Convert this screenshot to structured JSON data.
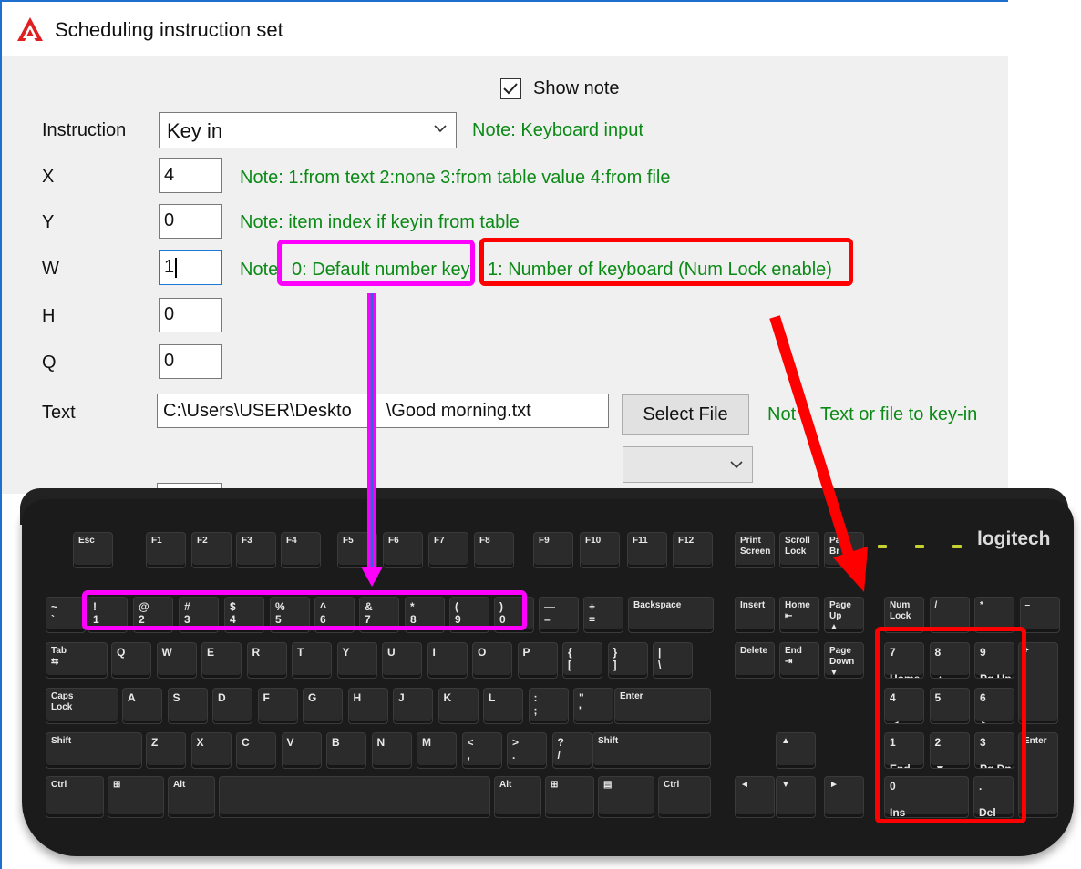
{
  "window": {
    "title": "Scheduling instruction set"
  },
  "show_note": {
    "label": "Show note",
    "checked": true
  },
  "fields": {
    "instruction": {
      "label": "Instruction",
      "value": "Key in",
      "note": "Note: Keyboard input"
    },
    "x": {
      "label": "X",
      "value": "4",
      "note": "Note: 1:from text 2:none 3:from table value 4:from file"
    },
    "y": {
      "label": "Y",
      "value": "0",
      "note": "Note: item index if keyin from table"
    },
    "w": {
      "label": "W",
      "value": "1",
      "note_prefix": "Note",
      "note_opt0": "0: Default number key",
      "note_opt1": "1: Number of keyboard (Num Lock enable)"
    },
    "h": {
      "label": "H",
      "value": "0"
    },
    "q": {
      "label": "Q",
      "value": "0"
    },
    "text": {
      "label": "Text",
      "value": "C:\\Users\\USER\\Deskto",
      "value_tail": "\\Good morning.txt",
      "button": "Select File",
      "note_head": "Not",
      "note_tail": "Text or file to key-in"
    }
  },
  "keyboard": {
    "brand": "logitech",
    "fn_row": [
      "Esc",
      "F1",
      "F2",
      "F3",
      "F4",
      "F5",
      "F6",
      "F7",
      "F8",
      "F9",
      "F10",
      "F11",
      "F12",
      "Print\nScreen",
      "Scroll\nLock",
      "Pa\nBr"
    ],
    "number_row": [
      "~\n`",
      "!\n1",
      "@\n2",
      "#\n3",
      "$\n4",
      "%\n5",
      "^\n6",
      "&\n7",
      "*\n8",
      "(\n9",
      ")\n0",
      "—\n–",
      "+\n=",
      "Backspace"
    ],
    "nav_row1": [
      "Insert",
      "Home\n⇤",
      "Page\nUp\n▲"
    ],
    "nav_row2": [
      "Delete",
      "End\n⇥",
      "Page\nDown\n▼"
    ],
    "row_q": [
      "Tab\n⇆",
      "Q",
      "W",
      "E",
      "R",
      "T",
      "Y",
      "U",
      "I",
      "O",
      "P",
      "{\n[",
      "}\n]",
      "|\n\\"
    ],
    "row_a": [
      "Caps\nLock",
      "A",
      "S",
      "D",
      "F",
      "G",
      "H",
      "J",
      "K",
      "L",
      ":\n;",
      "\"\n'",
      "Enter"
    ],
    "row_z": [
      "Shift",
      "Z",
      "X",
      "C",
      "V",
      "B",
      "N",
      "M",
      "<\n,",
      ">\n.",
      "?\n/",
      "Shift"
    ],
    "row_bottom": [
      "Ctrl",
      "⊞",
      "Alt",
      "",
      "Alt",
      "⊞",
      "▤",
      "Ctrl"
    ],
    "arrows": [
      "▲",
      "◄",
      "▼",
      "►"
    ],
    "numpad_top": [
      "Num\nLock",
      "/",
      "*",
      "–"
    ],
    "numpad_7": [
      "7\n\nHome",
      "8\n\n▲",
      "9\n\nPg Up"
    ],
    "numpad_4": [
      "4\n\n◄",
      "5",
      "6\n\n►"
    ],
    "numpad_1": [
      "1\n\nEnd",
      "2\n\n▼",
      "3\n\nPg Dn"
    ],
    "numpad_0": [
      "0\n\nIns",
      ".\n\nDel"
    ],
    "numpad_plus": "+",
    "numpad_enter": "Enter"
  },
  "colors": {
    "note_green": "#0b8a16",
    "magenta": "#ff00ff",
    "red": "#ff0000",
    "title_blue": "#1f6fd0"
  }
}
